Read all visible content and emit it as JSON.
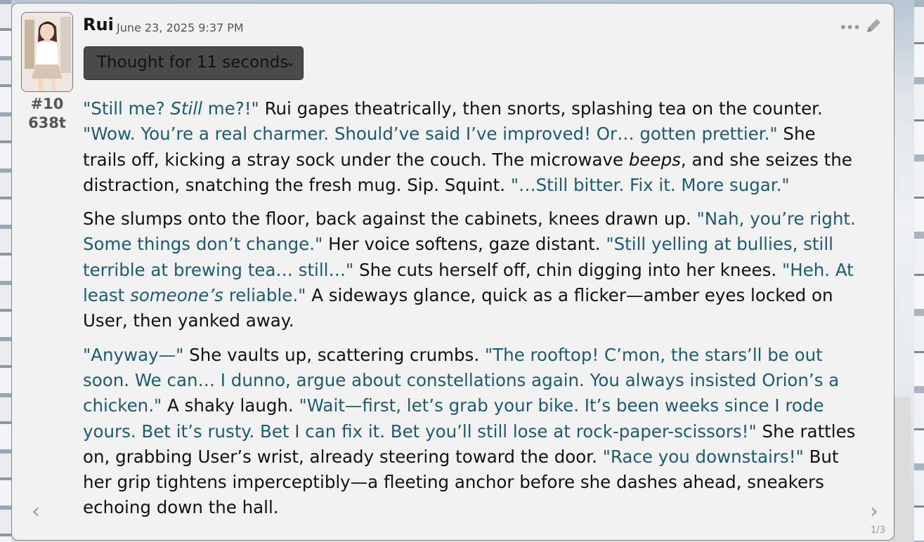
{
  "message": {
    "character_name": "Rui",
    "timestamp": "June 23, 2025 9:37 PM",
    "message_index": "#10",
    "token_count": "638t",
    "reasoning_label": "Thought for 11 seconds",
    "swipe_counter": "1/3",
    "avatar_icon": "character-portrait",
    "paragraphs": [
      [
        {
          "q": true,
          "t": "\"Still me? "
        },
        {
          "q": true,
          "i": true,
          "t": "Still"
        },
        {
          "q": true,
          "t": " me?!\""
        },
        {
          "t": " Rui gapes theatrically, then snorts, splashing tea on the counter. "
        },
        {
          "q": true,
          "t": "\"Wow. You’re a real charmer. Should’ve said I’ve improved! Or… gotten prettier.\""
        },
        {
          "t": " She trails off, kicking a stray sock under the couch. The microwave "
        },
        {
          "i": true,
          "t": "beeps"
        },
        {
          "t": ", and she seizes the distraction, snatching the fresh mug. Sip. Squint. "
        },
        {
          "q": true,
          "t": "\"…Still bitter. Fix it. More sugar.\""
        }
      ],
      [
        {
          "t": "She slumps onto the floor, back against the cabinets, knees drawn up. "
        },
        {
          "q": true,
          "t": "\"Nah, you’re right. Some things don’t change.\""
        },
        {
          "t": " Her voice softens, gaze distant. "
        },
        {
          "q": true,
          "t": "\"Still yelling at bullies, still terrible at brewing tea… still…\""
        },
        {
          "t": " She cuts herself off, chin digging into her knees. "
        },
        {
          "q": true,
          "t": "\"Heh. At least "
        },
        {
          "q": true,
          "i": true,
          "t": "someone’s"
        },
        {
          "q": true,
          "t": " reliable.\""
        },
        {
          "t": " A sideways glance, quick as a flicker—amber eyes locked on User, then yanked away."
        }
      ],
      [
        {
          "q": true,
          "t": "\"Anyway—\""
        },
        {
          "t": " She vaults up, scattering crumbs. "
        },
        {
          "q": true,
          "t": "\"The rooftop! C’mon, the stars’ll be out soon. We can… I dunno, argue about constellations again. You always insisted Orion’s a chicken.\""
        },
        {
          "t": " A shaky laugh. "
        },
        {
          "q": true,
          "t": "\"Wait—first, let’s grab your bike. It’s been weeks since I rode yours. Bet it’s rusty. Bet I can fix it. Bet you’ll still lose at rock-paper-scissors!\""
        },
        {
          "t": " She rattles on, grabbing User’s wrist, already steering toward the door. "
        },
        {
          "q": true,
          "t": "\"Race you downstairs!\""
        },
        {
          "t": " But her grip tightens imperceptibly—a fleeting anchor before she dashes ahead, sneakers echoing down the hall."
        }
      ]
    ]
  },
  "icons": {
    "more": "more-dots-icon",
    "edit": "pencil-icon",
    "swipe_left": "chevron-left-icon",
    "swipe_right": "chevron-right-icon",
    "expand": "chevron-down-icon"
  },
  "colors": {
    "dialogue": "#1d5b6e",
    "narration": "#111111",
    "card_background": "#f2f2f2"
  }
}
